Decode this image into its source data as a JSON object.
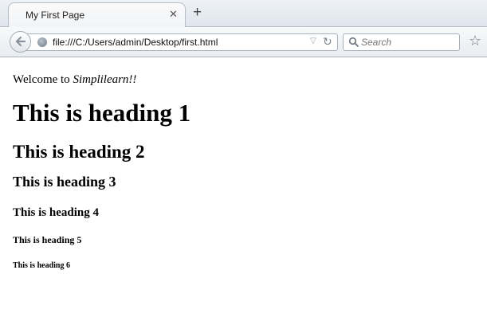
{
  "browser": {
    "tab": {
      "title": "My First Page",
      "close_symbol": "✕"
    },
    "new_tab_symbol": "+",
    "nav": {
      "back_icon": "back-arrow-icon",
      "url": "file:///C:/Users/admin/Desktop/first.html",
      "dropdown_symbol": "▽",
      "reload_symbol": "↻",
      "search_placeholder": "Search",
      "bookmark_symbol": "☆"
    }
  },
  "page": {
    "welcome_prefix": "Welcome to ",
    "welcome_emphasis": "Simplilearn!!",
    "headings": {
      "h1": "This is heading 1",
      "h2": "This is heading 2",
      "h3": "This is heading 3",
      "h4": "This is heading 4",
      "h5": "This is heading 5",
      "h6": "This is heading 6"
    }
  }
}
